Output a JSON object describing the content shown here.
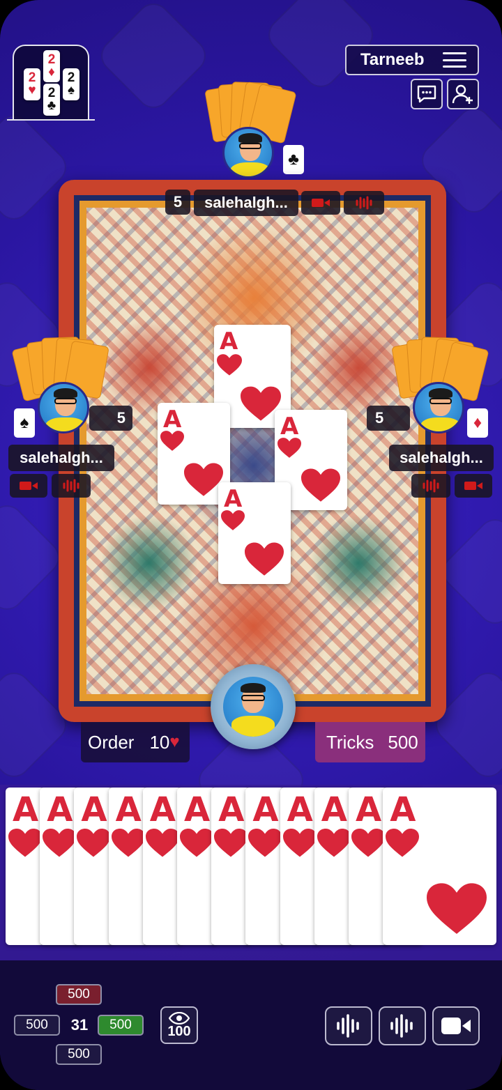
{
  "app": {
    "title": "Tarneeb"
  },
  "trump_indicator": {
    "cards": [
      {
        "rank": "2",
        "suit": "♥",
        "color": "red"
      },
      {
        "rank": "2",
        "suit": "♦",
        "color": "red"
      },
      {
        "rank": "2",
        "suit": "♣",
        "color": "black"
      },
      {
        "rank": "2",
        "suit": "♠",
        "color": "black"
      }
    ]
  },
  "toolbar": {
    "chat_icon": "chat-icon",
    "add_user_icon": "add-user-icon",
    "menu_icon": "hamburger-icon"
  },
  "players": {
    "top": {
      "name": "salehalgh...",
      "count": "5",
      "bid_suit": "♣"
    },
    "left": {
      "name": "salehalgh...",
      "count": "5",
      "bid_suit": "♠"
    },
    "right": {
      "name": "salehalgh...",
      "count": "5",
      "bid_suit": "♦"
    }
  },
  "table_cards": [
    {
      "rank": "A",
      "suit": "♥",
      "from": "top"
    },
    {
      "rank": "A",
      "suit": "♥",
      "from": "left"
    },
    {
      "rank": "A",
      "suit": "♥",
      "from": "right"
    },
    {
      "rank": "A",
      "suit": "♥",
      "from": "bottom"
    }
  ],
  "order": {
    "label": "Order",
    "value": "10",
    "suit": "♥"
  },
  "tricks": {
    "label": "Tricks",
    "value": "500"
  },
  "hand": {
    "cards": [
      "A",
      "A",
      "A",
      "A",
      "A",
      "A",
      "A",
      "A",
      "A",
      "A",
      "A",
      "A"
    ],
    "suit": "♥"
  },
  "scores": {
    "top": "500",
    "left": "500",
    "center": "31",
    "right": "500",
    "bottom": "500"
  },
  "spectators": {
    "icon": "eye-icon",
    "count": "100"
  },
  "bottom_controls": [
    "audio-wave-icon",
    "audio-wave-icon",
    "video-camera-icon"
  ],
  "colors": {
    "background": "#2c17a6",
    "card_red": "#d9263a",
    "tricks_bg": "#8a2f7c",
    "green_chip": "#2e8a2e",
    "red_chip": "#7a1f2e"
  }
}
